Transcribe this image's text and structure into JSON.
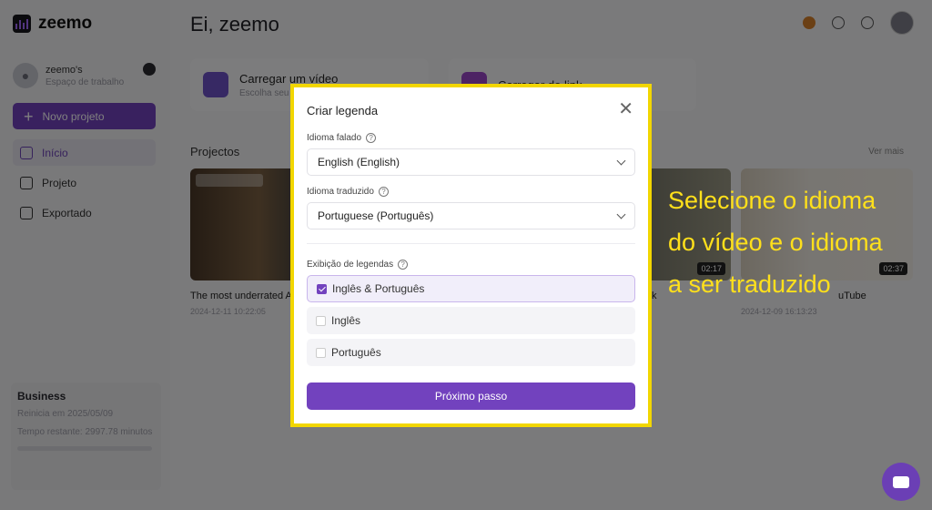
{
  "sidebar": {
    "logo": "zeemo",
    "workspace_name": "zeemo's",
    "workspace_sub": "Espaço de trabalho",
    "new_project": "Novo projeto",
    "nav": [
      {
        "label": "Início",
        "icon": "home-icon"
      },
      {
        "label": "Projeto",
        "icon": "project-icon"
      },
      {
        "label": "Exportado",
        "icon": "export-icon"
      }
    ],
    "plan": {
      "name": "Business",
      "renews": "Reinicia em 2025/05/09",
      "time_left": "Tempo restante: 2997.78 minutos"
    }
  },
  "header": {
    "greeting": "Ei, zeemo"
  },
  "upload": {
    "video_label": "Carregar um vídeo",
    "video_sub": "Escolha seu",
    "link_label": "Carregar do link"
  },
  "projects": {
    "title": "Projectos",
    "see_more": "Ver mais",
    "items": [
      {
        "title": "The most underrated A",
        "date": "2024-12-11 10:22:05",
        "duration": ""
      },
      {
        "title": "k",
        "date": "",
        "duration": "02:17"
      },
      {
        "title": "uTube",
        "date": "2024-12-09 16:13:23",
        "duration": "02:37"
      }
    ]
  },
  "caption": {
    "line1": "Selecione o idioma",
    "line2": "do vídeo e o idioma",
    "line3": "a ser traduzido"
  },
  "modal": {
    "title": "Criar legenda",
    "spoken_label": "Idioma falado",
    "spoken_value": "English (English)",
    "translated_label": "Idioma traduzido",
    "translated_value": "Portuguese (Português)",
    "display_label": "Exibição de legendas",
    "options": [
      {
        "label": "Inglês & Português",
        "checked": true
      },
      {
        "label": "Inglês",
        "checked": false
      },
      {
        "label": "Português",
        "checked": false
      }
    ],
    "next_button": "Próximo passo"
  },
  "colors": {
    "accent": "#7242be",
    "highlight_border": "#f2d600",
    "caption_text": "#ffe01b"
  }
}
